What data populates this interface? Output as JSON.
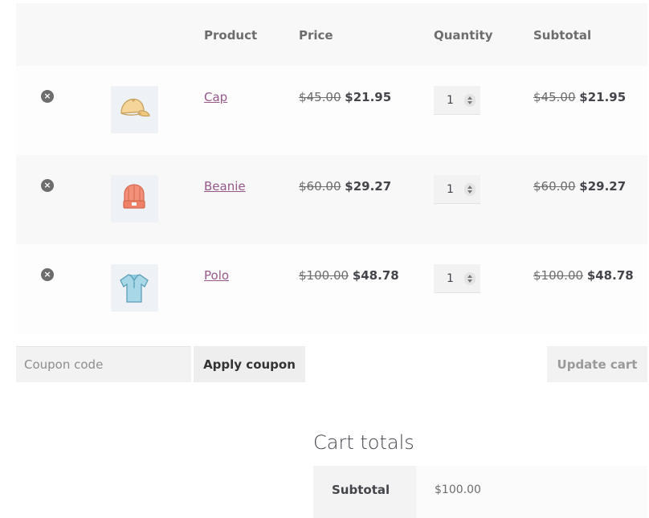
{
  "table": {
    "headers": [
      "Product",
      "Price",
      "Quantity",
      "Subtotal"
    ],
    "rows": [
      {
        "name": "Cap",
        "icon": "cap-image",
        "price_old": "$45.00",
        "price_new": "$21.95",
        "qty": "1",
        "sub_old": "$45.00",
        "sub_new": "$21.95"
      },
      {
        "name": "Beanie",
        "icon": "beanie-image",
        "price_old": "$60.00",
        "price_new": "$29.27",
        "qty": "1",
        "sub_old": "$60.00",
        "sub_new": "$29.27"
      },
      {
        "name": "Polo",
        "icon": "polo-image",
        "price_old": "$100.00",
        "price_new": "$48.78",
        "qty": "1",
        "sub_old": "$100.00",
        "sub_new": "$48.78"
      }
    ],
    "remove_glyph": "×"
  },
  "actions": {
    "coupon_placeholder": "Coupon code",
    "apply_label": "Apply coupon",
    "update_label": "Update cart"
  },
  "totals": {
    "title": "Cart totals",
    "subtotal_label": "Subtotal",
    "subtotal_value": "$100.00"
  },
  "colors": {
    "link": "#96588a",
    "header_bg": "#f8f8f8"
  }
}
